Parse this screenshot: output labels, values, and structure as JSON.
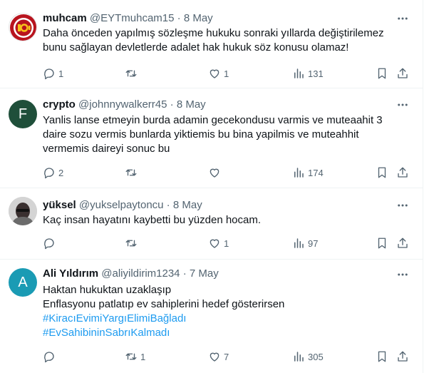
{
  "tweets": [
    {
      "name": "muhcam",
      "handle": "@EYTmuhcam15",
      "date": "8 May",
      "lines": [
        "Daha önceden yapılmış sözleşme hukuku sonraki yıllarda değiştirilemez",
        "bunu sağlayan devletlerde adalet hak hukuk söz konusu olamaz!"
      ],
      "avatar_text": "",
      "replies": "1",
      "retweets": "",
      "likes": "1",
      "views": "131"
    },
    {
      "name": "crypto",
      "handle": "@johnnywalkerr45",
      "date": "8 May",
      "lines": [
        "Yanlis lanse etmeyin burda adamin gecekondusu varmis ve muteaahit 3",
        "daire sozu vermis bunlarda yiktiemis bu bina yapilmis ve muteahhit",
        "vermemis daireyi sonuc bu"
      ],
      "avatar_text": "F",
      "replies": "2",
      "retweets": "",
      "likes": "",
      "views": "174"
    },
    {
      "name": "yüksel",
      "handle": "@yukselpaytoncu",
      "date": "8 May",
      "lines": [
        "Kaç insan hayatını kaybetti bu yüzden hocam."
      ],
      "avatar_text": "",
      "replies": "",
      "retweets": "",
      "likes": "1",
      "views": "97"
    },
    {
      "name": "Ali Yıldırım",
      "handle": "@aliyildirim1234",
      "date": "7 May",
      "lines": [
        "Haktan hukuktan uzaklaşıp",
        "Enflasyonu patlatıp ev sahiplerini hedef gösterirsen"
      ],
      "hashtags": [
        "#KiracıEvimiYargıElimiBağladı",
        "#EvSahibininSabrıKalmadı"
      ],
      "avatar_text": "A",
      "replies": "",
      "retweets": "1",
      "likes": "7",
      "views": "305"
    }
  ],
  "separator": "·",
  "colors": {
    "text": "#0f1419",
    "secondary": "#536471",
    "link": "#1d9bf0",
    "avatar_crypto": "#1f4f3a",
    "avatar_ali": "#1a9bb4",
    "muhcam_badge": "#b8141e"
  },
  "icons": [
    "more-icon",
    "reply-icon",
    "retweet-icon",
    "like-icon",
    "views-icon",
    "bookmark-icon",
    "share-icon"
  ]
}
